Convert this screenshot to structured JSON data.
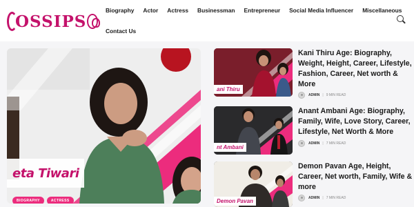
{
  "site": {
    "logo_text": "OSSIPS"
  },
  "nav": {
    "items": [
      "Biography",
      "Actor",
      "Actress",
      "Businessman",
      "Entrepreneur",
      "Social Media Influencer",
      "Miscellaneous"
    ],
    "items_second_row": [
      "Contact Us"
    ]
  },
  "featured": {
    "name_overlay": "eta Tiwari",
    "badges": [
      "BIOGRAPHY",
      "ACTRESS"
    ]
  },
  "posts": [
    {
      "thumb_label": "ani Thiru",
      "title": "Kani Thiru Age: Biography, Weight, Height, Career, Lifestyle, Fashion, Career, Net worth & More",
      "author": "ADMIN",
      "read_time": "9 MIN READ"
    },
    {
      "thumb_label": "nt Ambani",
      "title": "Anant Ambani Age: Biography, Family, Wife, Love Story, Career, Lifestyle, Net Worth & More",
      "author": "ADMIN",
      "read_time": "7 MIN READ"
    },
    {
      "thumb_label": "Demon Pavan",
      "title": "Demon Pavan Age, Height, Career, Net worth, Family, Wife & more",
      "author": "ADMIN",
      "read_time": "7 MIN READ"
    }
  ],
  "colors": {
    "brand": "#c4126b",
    "badge": "#ec2c7d",
    "text": "#1a1a1a"
  },
  "icons": {
    "search": "search-icon",
    "avatar": "author-avatar"
  }
}
